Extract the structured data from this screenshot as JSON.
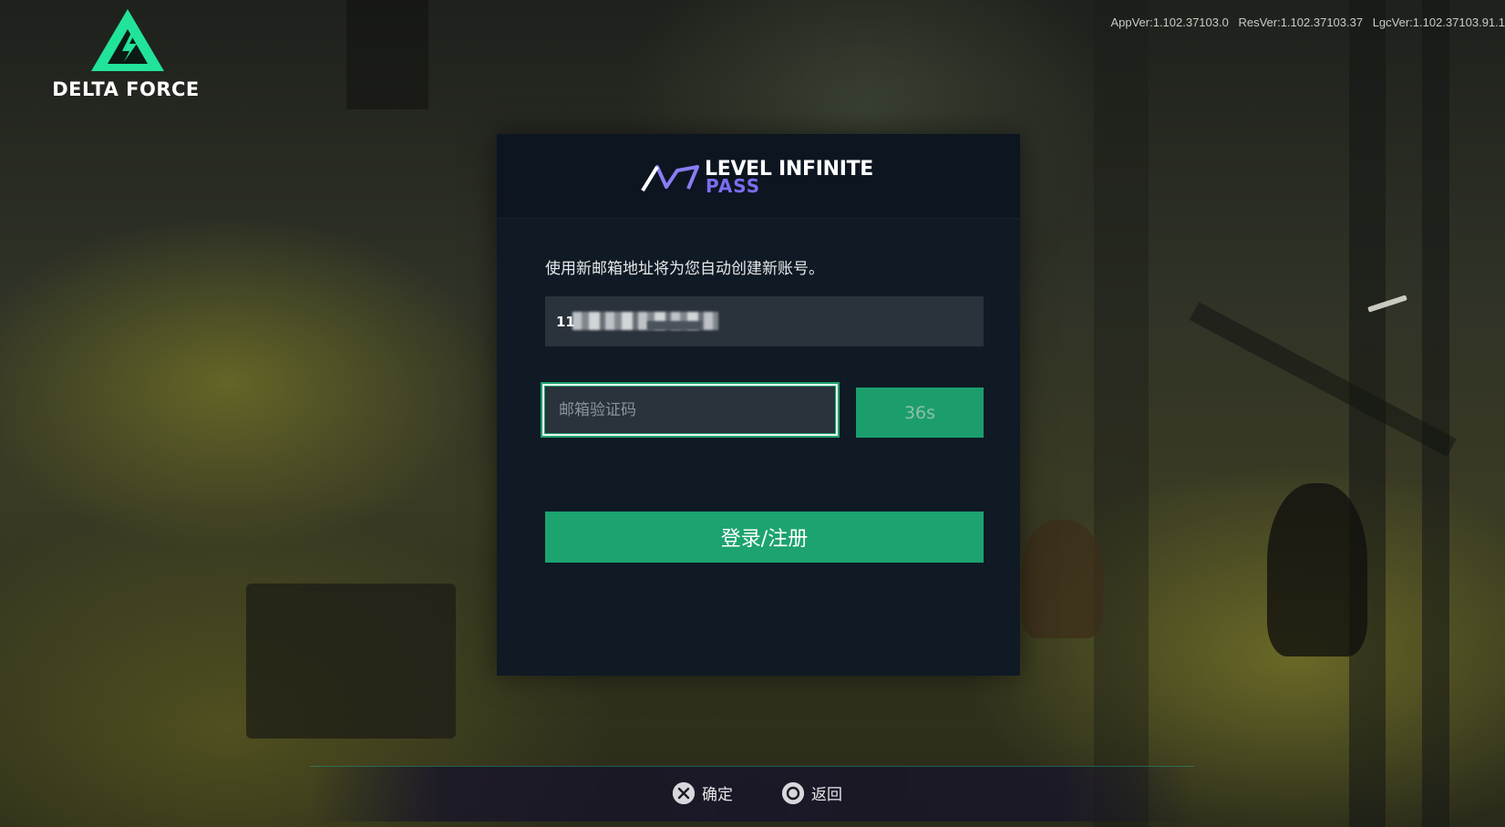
{
  "header": {
    "logo_text": "DELTA FORCE",
    "version": {
      "app": "AppVer:1.102.37103.0",
      "res": "ResVer:1.102.37103.37",
      "lgc": "LgcVer:1.102.37103.91.1"
    }
  },
  "dialog": {
    "brand_line1": "LEVEL INFINITE",
    "brand_line2": "PASS",
    "hint": "使用新邮箱地址将为您自动创建新账号。",
    "email_value": "11",
    "code_placeholder": "邮箱验证码",
    "code_value": "",
    "countdown_label": "36s",
    "login_label": "登录/注册"
  },
  "footer": {
    "confirm_label": "确定",
    "back_label": "返回"
  },
  "colors": {
    "accent": "#1ca36f",
    "brand_purple": "#7b6df0",
    "dialog_bg": "#0f1a24"
  }
}
